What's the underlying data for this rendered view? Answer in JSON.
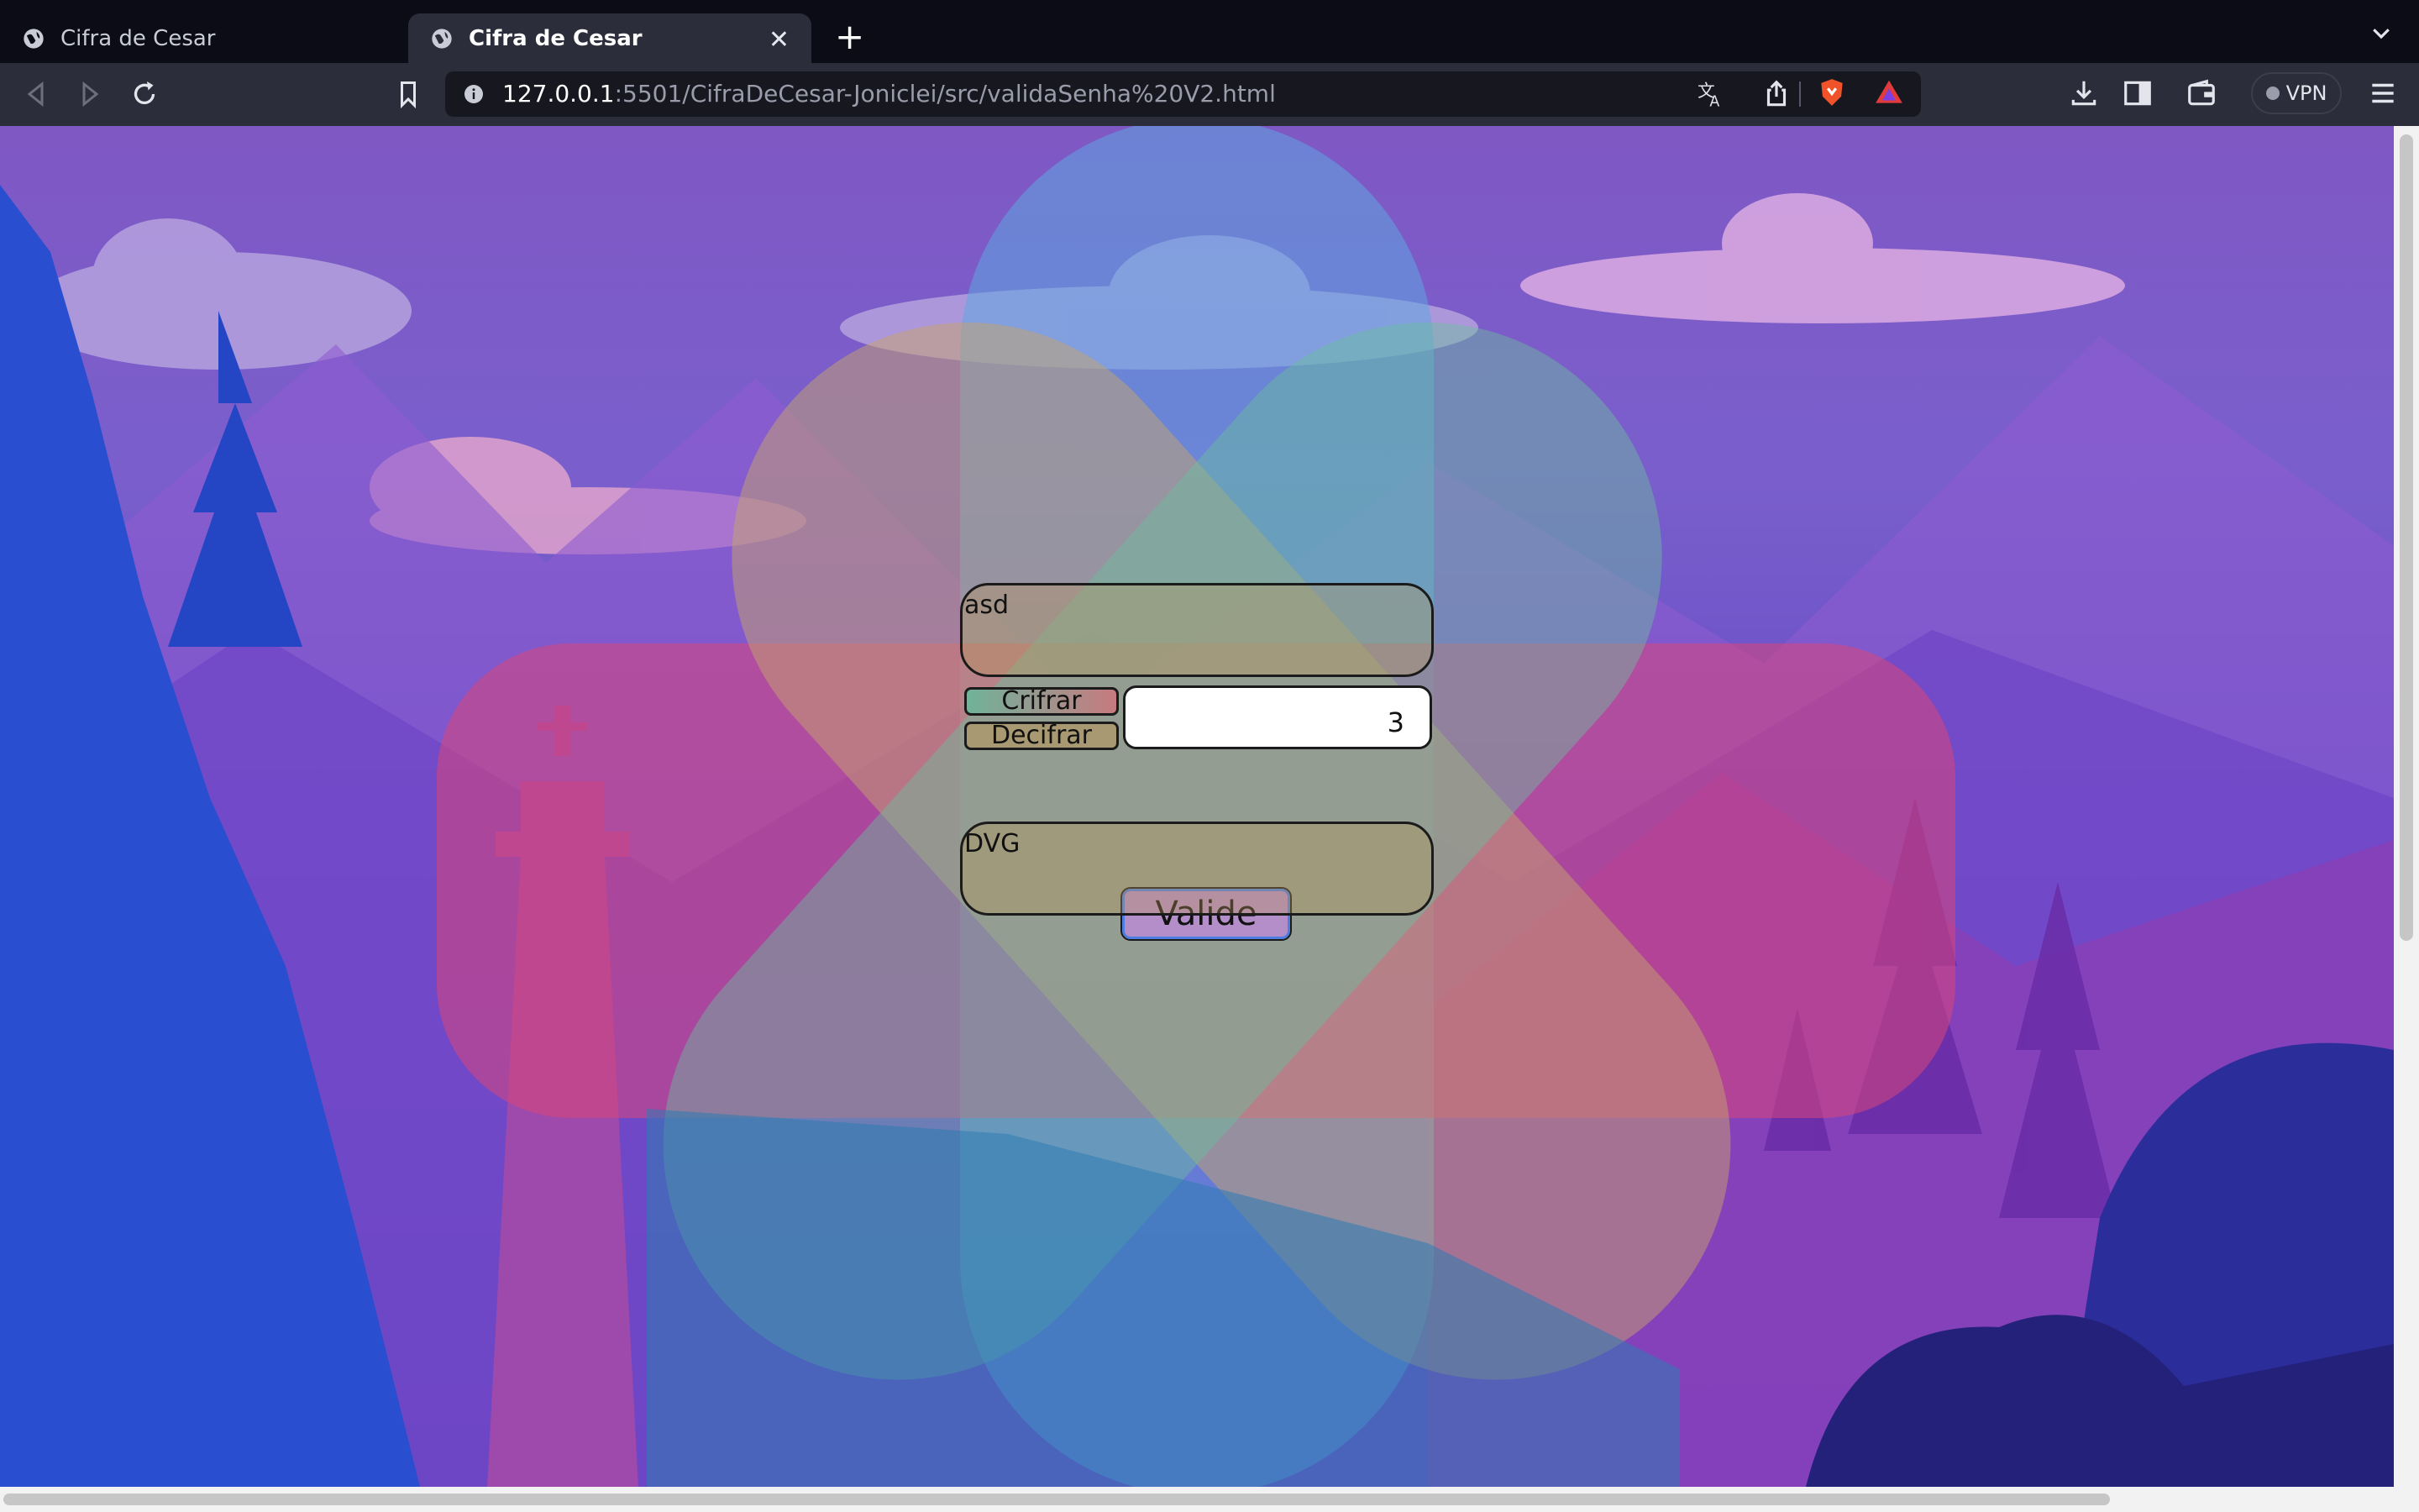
{
  "browser": {
    "tabs": [
      {
        "title": "Cifra de Cesar",
        "active": false
      },
      {
        "title": "Cifra de Cesar",
        "active": true
      }
    ],
    "url_host": "127.0.0.1",
    "url_rest": ":5501/CifraDeCesar-Joniclei/src/validaSenha%20V2.html",
    "vpn_label": "VPN",
    "icons": [
      "globe-icon",
      "close-icon",
      "plus-icon",
      "chevron-down-icon",
      "back-icon",
      "forward-icon",
      "reload-icon",
      "bookmark-icon",
      "info-icon",
      "translate-icon",
      "share-icon",
      "brave-shield-icon",
      "brave-rewards-icon",
      "download-icon",
      "sidebar-icon",
      "wallet-icon",
      "menu-icon"
    ]
  },
  "form": {
    "input_text": "asd",
    "option_encrypt": "Crifrar",
    "option_decrypt": "Decifrar",
    "shift_value": "3",
    "submit_label": "Valide",
    "output_text": "DVG"
  },
  "colors": {
    "accent": "#4d7de0",
    "button_bg": "#b38ec8"
  }
}
